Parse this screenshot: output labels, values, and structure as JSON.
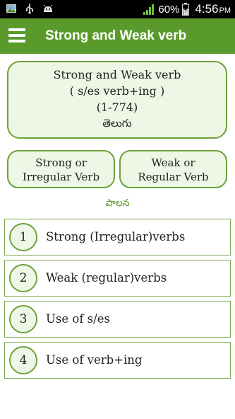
{
  "status_bar": {
    "icons": [
      "photo-notification-icon",
      "usb-icon",
      "android-debug-icon"
    ],
    "battery_percent_text": "60%",
    "battery_level": 0.6,
    "signal_icon": "signal-bars-icon",
    "battery_icon": "battery-charging-icon",
    "time": "4:56",
    "time_suffix": "PM"
  },
  "app_bar": {
    "menu_icon": "hamburger-menu-icon",
    "title": "Strong and Weak verb"
  },
  "header_card": {
    "line1": "Strong and Weak verb",
    "line2": "( s/es verb+ing )",
    "line3": "(1-774)",
    "line4": "తెలుగు"
  },
  "type_buttons": {
    "strong_line1": "Strong or",
    "strong_line2": "Irregular Verb",
    "weak_line1": "Weak or",
    "weak_line2": "Regular Verb"
  },
  "sub_label": "పాలన",
  "list": [
    {
      "num": "1",
      "label": "Strong (Irregular)verbs"
    },
    {
      "num": "2",
      "label": "Weak (regular)verbs"
    },
    {
      "num": "3",
      "label": "Use of s/es"
    },
    {
      "num": "4",
      "label": "Use of verb+ing"
    }
  ],
  "colors": {
    "app_bar": "#5a9a2c",
    "accent_border": "#6aa33a",
    "card_fill": "#eef7e6",
    "status_bar": "#000000"
  }
}
